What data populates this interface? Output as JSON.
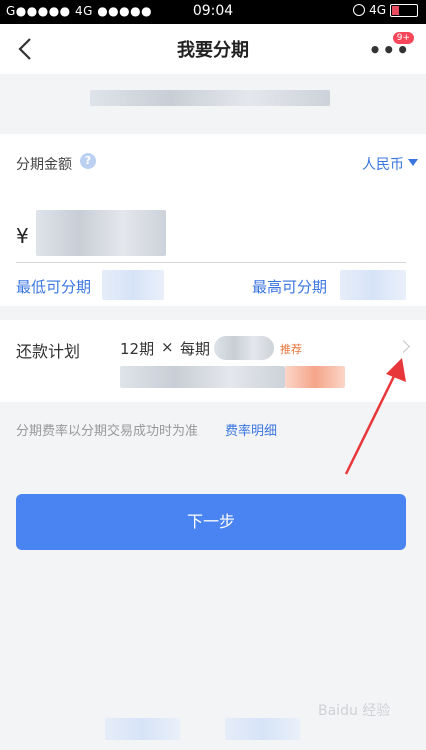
{
  "status_bar": {
    "carrier": "G●●●●● 4G ●●●●●",
    "time": "09:04",
    "network": "4G"
  },
  "nav": {
    "title": "我要分期",
    "badge": "9+"
  },
  "amount_card": {
    "label": "分期金额",
    "help_icon": "?",
    "currency": "人民币",
    "currency_symbol": "¥",
    "min_label": "最低可分期",
    "max_label": "最高可分期"
  },
  "plan_card": {
    "label": "还款计划",
    "periods": "12期",
    "times": "×",
    "each": "每期",
    "recommend": "推荐"
  },
  "note": {
    "text": "分期费率以分期交易成功时为准",
    "link": "费率明细"
  },
  "next_button": "下一步",
  "watermark": "Baidu 经验",
  "colors": {
    "accent": "#4a84f3",
    "link": "#3a76e0",
    "recommend": "#e8753b",
    "arrow": "#e8373a"
  }
}
